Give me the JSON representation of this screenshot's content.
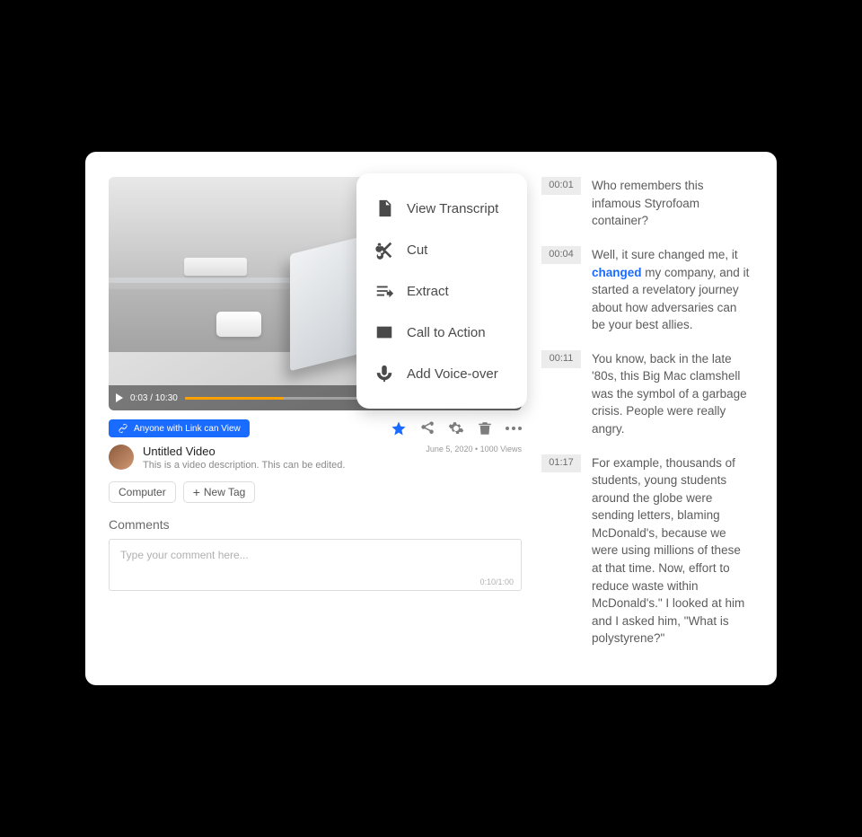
{
  "player": {
    "time_label": "0:03 / 10:30"
  },
  "popup": {
    "items": [
      {
        "icon": "doc",
        "label": "View Transcript"
      },
      {
        "icon": "cut",
        "label": "Cut"
      },
      {
        "icon": "extract",
        "label": "Extract"
      },
      {
        "icon": "cta",
        "label": "Call to Action"
      },
      {
        "icon": "mic",
        "label": "Add Voice-over"
      }
    ]
  },
  "share_chip": "Anyone with Link can View",
  "video": {
    "title": "Untitled Video",
    "description": "This is a video description. This can be edited.",
    "date": "June 5, 2020",
    "views": "1000 Views"
  },
  "tags": {
    "existing": "Computer",
    "new_label": "New Tag"
  },
  "comments": {
    "heading": "Comments",
    "placeholder": "Type your comment here...",
    "char_count": "0:10/1:00"
  },
  "transcript": [
    {
      "t": "00:01",
      "text": "Who remembers this infamous Styrofoam container?"
    },
    {
      "t": "00:04",
      "highlight": "changed",
      "pre": "Well, it sure changed me, it ",
      "post": " my company, and it started a revelatory journey about how adversaries can be your best allies."
    },
    {
      "t": "00:11",
      "text": "You know, back in the late '80s, this Big Mac clamshell was the symbol of a garbage crisis. People were really angry."
    },
    {
      "t": "01:17",
      "text": "For example, thousands of students, young students around the globe were sending letters, blaming McDonald's, because we were using millions of these at that time. Now, effort to reduce waste within McDonald's.\" I looked at him and I asked him, \"What is polystyrene?\""
    }
  ]
}
